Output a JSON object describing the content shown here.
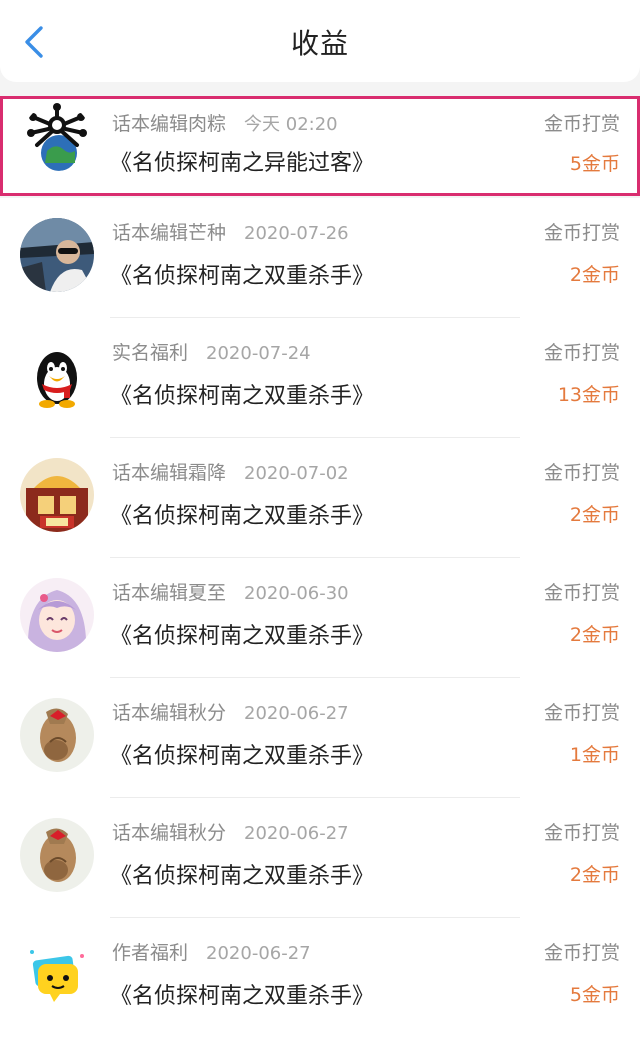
{
  "header": {
    "title": "收益",
    "back_icon": "chevron-left-icon",
    "accent": "#3a8ee6"
  },
  "colors": {
    "highlight_border": "#d92d6f",
    "amount": "#e47a3e"
  },
  "items": [
    {
      "source": "话本编辑肉粽",
      "date": "今天 02:20",
      "book": "《名侦探柯南之异能过客》",
      "type": "金币打赏",
      "amount": "5金币",
      "avatar": "spiky-character-avatar"
    },
    {
      "source": "话本编辑芒种",
      "date": "2020-07-26",
      "book": "《名侦探柯南之双重杀手》",
      "type": "金币打赏",
      "amount": "2金币",
      "avatar": "photo-avatar"
    },
    {
      "source": "实名福利",
      "date": "2020-07-24",
      "book": "《名侦探柯南之双重杀手》",
      "type": "金币打赏",
      "amount": "13金币",
      "avatar": "penguin-avatar"
    },
    {
      "source": "话本编辑霜降",
      "date": "2020-07-02",
      "book": "《名侦探柯南之双重杀手》",
      "type": "金币打赏",
      "amount": "2金币",
      "avatar": "cartoon-avatar"
    },
    {
      "source": "话本编辑夏至",
      "date": "2020-06-30",
      "book": "《名侦探柯南之双重杀手》",
      "type": "金币打赏",
      "amount": "2金币",
      "avatar": "anime-girl-avatar"
    },
    {
      "source": "话本编辑秋分",
      "date": "2020-06-27",
      "book": "《名侦探柯南之双重杀手》",
      "type": "金币打赏",
      "amount": "1金币",
      "avatar": "hair-bun-avatar"
    },
    {
      "source": "话本编辑秋分",
      "date": "2020-06-27",
      "book": "《名侦探柯南之双重杀手》",
      "type": "金币打赏",
      "amount": "2金币",
      "avatar": "hair-bun-avatar"
    },
    {
      "source": "作者福利",
      "date": "2020-06-27",
      "book": "《名侦探柯南之双重杀手》",
      "type": "金币打赏",
      "amount": "5金币",
      "avatar": "chat-bubble-avatar"
    }
  ]
}
